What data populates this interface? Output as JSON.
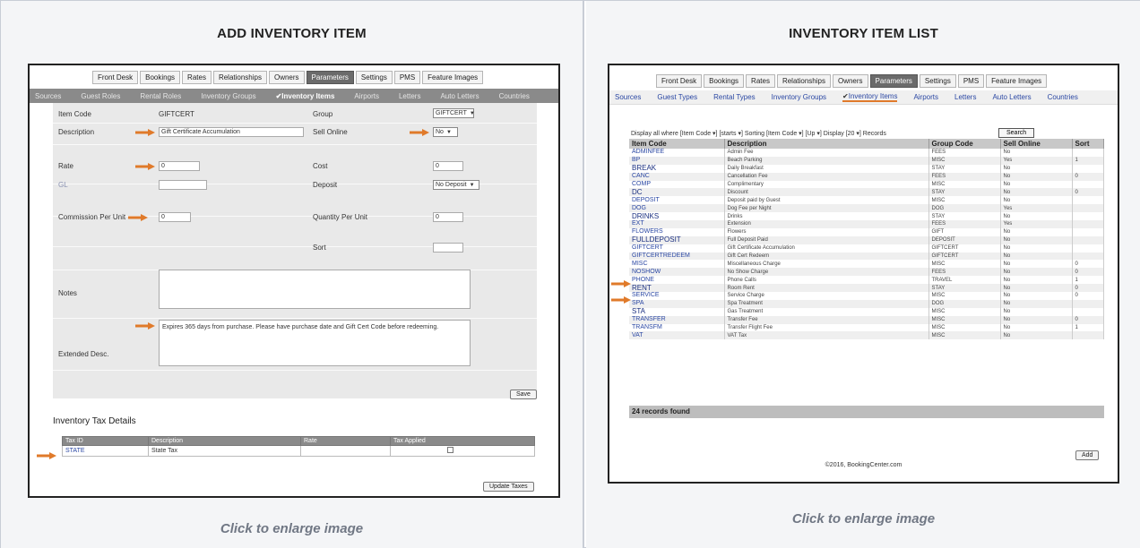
{
  "left": {
    "title": "ADD INVENTORY ITEM",
    "caption": "Click to enlarge image",
    "top_nav": [
      {
        "label": "Front Desk",
        "active": false
      },
      {
        "label": "Bookings",
        "active": false
      },
      {
        "label": "Rates",
        "active": false
      },
      {
        "label": "Relationships",
        "active": false
      },
      {
        "label": "Owners",
        "active": false
      },
      {
        "label": "Parameters",
        "active": true
      },
      {
        "label": "Settings",
        "active": false
      },
      {
        "label": "PMS",
        "active": false
      },
      {
        "label": "Feature Images",
        "active": false
      }
    ],
    "sub_nav": [
      {
        "label": "Sources",
        "active": false
      },
      {
        "label": "Guest Roles",
        "active": false
      },
      {
        "label": "Rental Roles",
        "active": false
      },
      {
        "label": "Inventory Groups",
        "active": false
      },
      {
        "label": "Inventory Items",
        "active": true
      },
      {
        "label": "Airports",
        "active": false
      },
      {
        "label": "Letters",
        "active": false
      },
      {
        "label": "Auto Letters",
        "active": false
      },
      {
        "label": "Countries",
        "active": false
      }
    ],
    "form": {
      "item_code_label": "Item Code",
      "item_code_value": "GIFTCERT",
      "group_label": "Group",
      "group_value": "GIFTCERT",
      "description_label": "Description",
      "description_value": "Gift Certificate Accumulation",
      "sell_online_label": "Sell Online",
      "sell_online_value": "No",
      "rate_label": "Rate",
      "rate_value": "0",
      "cost_label": "Cost",
      "cost_value": "0",
      "gl_label": "GL",
      "deposit_label": "Deposit",
      "deposit_value": "No Deposit",
      "commission_label": "Commission Per Unit",
      "commission_value": "0",
      "quantity_label": "Quantity Per Unit",
      "quantity_value": "0",
      "sort_label": "Sort",
      "notes_label": "Notes",
      "extended_label": "Extended Desc.",
      "extended_value": "Expires 365 days from purchase. Please have purchase date and Gift Cert Code before redeeming.",
      "save_label": "Save"
    },
    "tax": {
      "heading": "Inventory Tax Details",
      "columns": [
        "Tax ID",
        "Description",
        "Rate",
        "Tax Applied"
      ],
      "rows": [
        {
          "id": "STATE",
          "desc": "State Tax",
          "rate": ""
        }
      ],
      "update_label": "Update Taxes"
    }
  },
  "right": {
    "title": "INVENTORY ITEM LIST",
    "caption": "Click to enlarge image",
    "top_nav": [
      {
        "label": "Front Desk",
        "active": false
      },
      {
        "label": "Bookings",
        "active": false
      },
      {
        "label": "Rates",
        "active": false
      },
      {
        "label": "Relationships",
        "active": false
      },
      {
        "label": "Owners",
        "active": false
      },
      {
        "label": "Parameters",
        "active": true
      },
      {
        "label": "Settings",
        "active": false
      },
      {
        "label": "PMS",
        "active": false
      },
      {
        "label": "Feature Images",
        "active": false
      }
    ],
    "sub_nav": [
      {
        "label": "Sources",
        "active": false
      },
      {
        "label": "Guest Types",
        "active": false
      },
      {
        "label": "Rental Types",
        "active": false
      },
      {
        "label": "Inventory Groups",
        "active": false
      },
      {
        "label": "Inventory Items",
        "active": true
      },
      {
        "label": "Airports",
        "active": false
      },
      {
        "label": "Letters",
        "active": false
      },
      {
        "label": "Auto Letters",
        "active": false
      },
      {
        "label": "Countries",
        "active": false
      }
    ],
    "filter": {
      "text": "Display all where [Item Code ▾] [starts ▾]      Sorting [Item Code ▾] [Up ▾]  Display [20 ▾]   Records",
      "search_label": "Search"
    },
    "columns": [
      "Item Code",
      "Description",
      "Group Code",
      "Sell Online",
      "Sort"
    ],
    "rows": [
      {
        "code": "ADMINFEE",
        "desc": "Admin Fee",
        "group": "FEES",
        "sell": "No",
        "sort": ""
      },
      {
        "code": "BP",
        "desc": "Beach Parking",
        "group": "MISC",
        "sell": "Yes",
        "sort": "1"
      },
      {
        "code": "BREAK",
        "desc": "Daily Breakfast",
        "group": "STAY",
        "sell": "No",
        "sort": ""
      },
      {
        "code": "CANC",
        "desc": "Cancellation Fee",
        "group": "FEES",
        "sell": "No",
        "sort": "0"
      },
      {
        "code": "COMP",
        "desc": "Complimentary",
        "group": "MISC",
        "sell": "No",
        "sort": ""
      },
      {
        "code": "DC",
        "desc": "Discount",
        "group": "STAY",
        "sell": "No",
        "sort": "0"
      },
      {
        "code": "DEPOSIT",
        "desc": "Deposit paid by Guest",
        "group": "MISC",
        "sell": "No",
        "sort": ""
      },
      {
        "code": "DOG",
        "desc": "Dog Fee per Night",
        "group": "DOG",
        "sell": "Yes",
        "sort": ""
      },
      {
        "code": "DRINKS",
        "desc": "Drinks",
        "group": "STAY",
        "sell": "No",
        "sort": ""
      },
      {
        "code": "EXT",
        "desc": "Extension",
        "group": "FEES",
        "sell": "Yes",
        "sort": ""
      },
      {
        "code": "FLOWERS",
        "desc": "Flowers",
        "group": "GIFT",
        "sell": "No",
        "sort": ""
      },
      {
        "code": "FULLDEPOSIT",
        "desc": "Full Deposit Paid",
        "group": "DEPOSIT",
        "sell": "No",
        "sort": ""
      },
      {
        "code": "GIFTCERT",
        "desc": "Gift Certificate Accumulation",
        "group": "GIFTCERT",
        "sell": "No",
        "sort": ""
      },
      {
        "code": "GIFTCERTREDEEM",
        "desc": "Gift Cert Redeem",
        "group": "GIFTCERT",
        "sell": "No",
        "sort": ""
      },
      {
        "code": "MISC",
        "desc": "Miscellaneous Charge",
        "group": "MISC",
        "sell": "No",
        "sort": "0"
      },
      {
        "code": "NOSHOW",
        "desc": "No Show Charge",
        "group": "FEES",
        "sell": "No",
        "sort": "0"
      },
      {
        "code": "PHONE",
        "desc": "Phone Calls",
        "group": "TRAVEL",
        "sell": "No",
        "sort": "1"
      },
      {
        "code": "RENT",
        "desc": "Room Rent",
        "group": "STAY",
        "sell": "No",
        "sort": "0"
      },
      {
        "code": "SERVICE",
        "desc": "Service Charge",
        "group": "MISC",
        "sell": "No",
        "sort": "0"
      },
      {
        "code": "SPA",
        "desc": "Spa Treatment",
        "group": "DOG",
        "sell": "No",
        "sort": ""
      },
      {
        "code": "STA",
        "desc": "Gas Treatment",
        "group": "MISC",
        "sell": "No",
        "sort": ""
      },
      {
        "code": "TRANSFER",
        "desc": "Transfer Fee",
        "group": "MISC",
        "sell": "No",
        "sort": "0"
      },
      {
        "code": "TRANSFM",
        "desc": "Transfer Flight Fee",
        "group": "MISC",
        "sell": "No",
        "sort": "1"
      },
      {
        "code": "VAT",
        "desc": "VAT Tax",
        "group": "MISC",
        "sell": "No",
        "sort": ""
      }
    ],
    "records_found": "24 records found",
    "add_label": "Add",
    "footer": "©2016, BookingCenter.com"
  },
  "colors": {
    "accent_arrow": "#e07a2a",
    "link": "#2a47a3",
    "nav_active": "#6b6b6b"
  }
}
